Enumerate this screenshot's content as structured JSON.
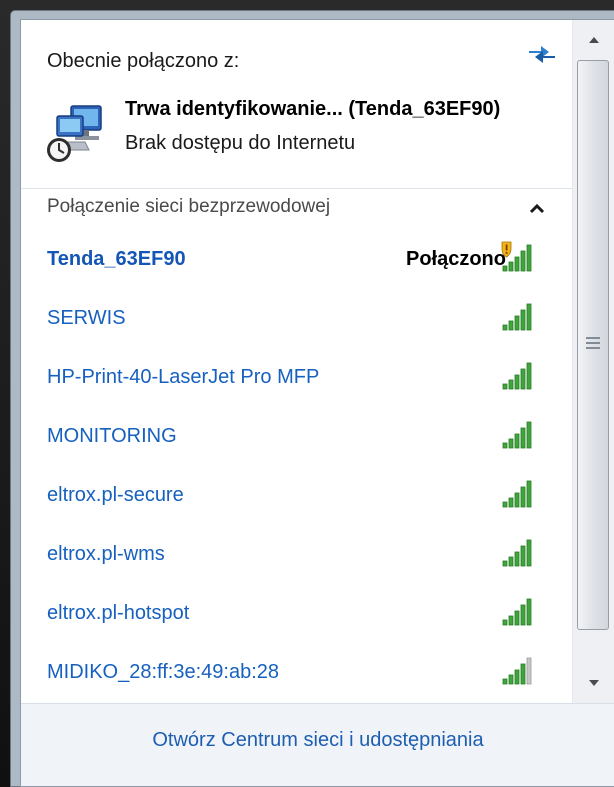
{
  "connection": {
    "heading": "Obecnie połączono z:",
    "network_name": "Trwa identyfikowanie... (Tenda_63EF90)",
    "status": "Brak dostępu do Internetu"
  },
  "section": {
    "title": "Połączenie sieci bezprzewodowej",
    "toggle_icon": "chevron-up-icon"
  },
  "networks": [
    {
      "ssid": "Tenda_63EF90",
      "state": "Połączono",
      "signal_bars": 5,
      "warning": true
    },
    {
      "ssid": "SERWIS",
      "state": "",
      "signal_bars": 5
    },
    {
      "ssid": "HP-Print-40-LaserJet Pro MFP",
      "state": "",
      "signal_bars": 5
    },
    {
      "ssid": "MONITORING",
      "state": "",
      "signal_bars": 5
    },
    {
      "ssid": "eltrox.pl-secure",
      "state": "",
      "signal_bars": 5
    },
    {
      "ssid": "eltrox.pl-wms",
      "state": "",
      "signal_bars": 5
    },
    {
      "ssid": "eltrox.pl-hotspot",
      "state": "",
      "signal_bars": 5
    },
    {
      "ssid": "MIDIKO_28:ff:3e:49:ab:28",
      "state": "",
      "signal_bars": 4
    }
  ],
  "footer": {
    "link": "Otwórz Centrum sieci i udostępniania"
  },
  "colors": {
    "link": "#1d5eb0",
    "ssid": "#1660bf",
    "signal_green": "#3ea63a",
    "signal_gray": "#c8c8c8"
  },
  "icons": {
    "refresh": "refresh-arrows-icon",
    "network": "network-unidentified-icon",
    "signal": "wifi-signal-icon",
    "warning": "shield-warning-icon"
  }
}
